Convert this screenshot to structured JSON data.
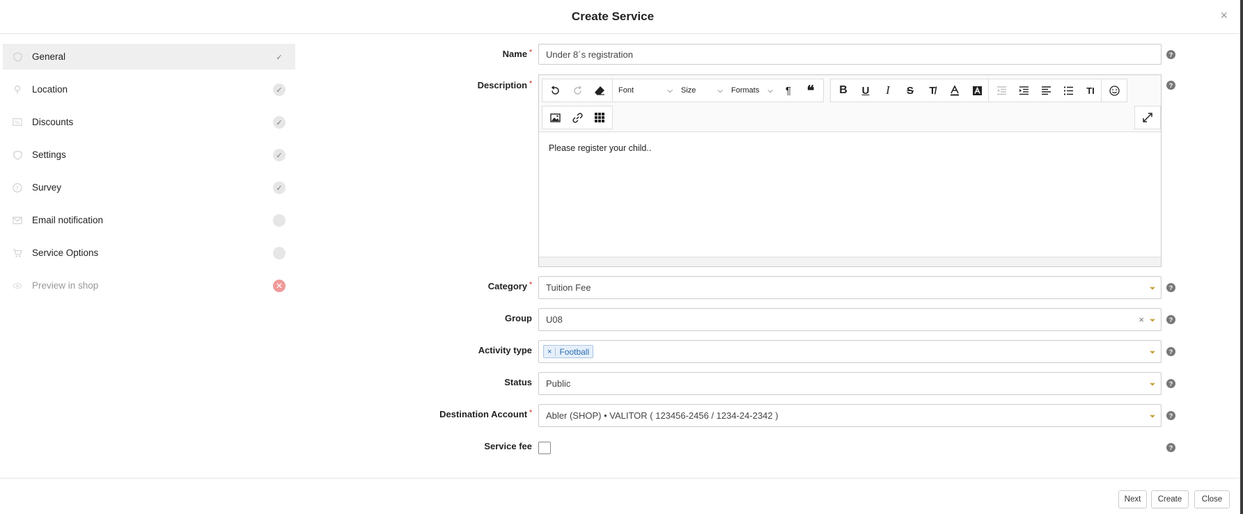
{
  "modal": {
    "title": "Create Service"
  },
  "sidebar": {
    "items": [
      {
        "label": "General",
        "status": "✓"
      },
      {
        "label": "Location",
        "status": "✓"
      },
      {
        "label": "Discounts",
        "status": "✓"
      },
      {
        "label": "Settings",
        "status": "✓"
      },
      {
        "label": "Survey",
        "status": "✓"
      },
      {
        "label": "Email notification",
        "status": ""
      },
      {
        "label": "Service Options",
        "status": ""
      },
      {
        "label": "Preview in shop",
        "status": "✕"
      }
    ]
  },
  "form": {
    "name": {
      "label": "Name",
      "required": "*",
      "value": "Under 8´s registration"
    },
    "description": {
      "label": "Description",
      "required": "*",
      "content": "Please register your child.."
    },
    "editor": {
      "font_label": "Font",
      "size_label": "Size",
      "formats_label": "Formats"
    },
    "category": {
      "label": "Category",
      "required": "*",
      "value": "Tuition Fee"
    },
    "group": {
      "label": "Group",
      "value": "U08",
      "clear": "×"
    },
    "activity_type": {
      "label": "Activity type",
      "tag": "Football",
      "tag_remove": "×"
    },
    "status": {
      "label": "Status",
      "value": "Public"
    },
    "destination_account": {
      "label": "Destination Account",
      "required": "*",
      "value": "Abler (SHOP) • VALITOR ( 123456-2456 / 1234-24-2342 )"
    },
    "service_fee": {
      "label": "Service fee",
      "checked": false
    }
  },
  "help": "?",
  "close_symbol": "×",
  "footer": {
    "next_label": "Next",
    "create_label": "Create",
    "close_label": "Close"
  },
  "colors": {
    "required": "#d9534f",
    "tag_bg": "#e6f0fb",
    "tag_text": "#2b6cb0",
    "caret": "#c9a23a",
    "error_status": "#ef9a9a"
  }
}
